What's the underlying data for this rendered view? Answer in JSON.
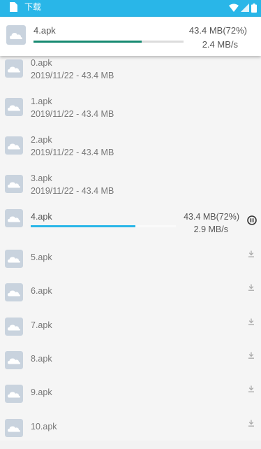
{
  "status_bar": {
    "title": "下载",
    "icons": [
      "document-icon",
      "wifi-icon",
      "signal-icon",
      "battery-icon"
    ]
  },
  "active_card": {
    "name": "4.apk",
    "size": "43.4 MB(72%)",
    "speed": "2.4 MB/s",
    "progress": 0.72,
    "colors": {
      "fill": "#188a72",
      "track": "#dcdcdc"
    }
  },
  "rows": [
    {
      "name": "0.apk",
      "meta": "2019/11/22 - 43.4 MB"
    },
    {
      "name": "1.apk",
      "meta": "2019/11/22 - 43.4 MB"
    },
    {
      "name": "2.apk",
      "meta": "2019/11/22 - 43.4 MB"
    },
    {
      "name": "3.apk",
      "meta": "2019/11/22 - 43.4 MB"
    },
    {
      "name": "4.apk",
      "size": "43.4 MB(72%)",
      "speed": "2.9 MB/s",
      "progress": 0.72,
      "action": "pause-icon"
    },
    {
      "name": "5.apk",
      "action": "download-icon"
    },
    {
      "name": "6.apk",
      "action": "download-icon"
    },
    {
      "name": "7.apk",
      "action": "download-icon"
    },
    {
      "name": "8.apk",
      "action": "download-icon"
    },
    {
      "name": "9.apk",
      "action": "download-icon"
    },
    {
      "name": "10.apk",
      "action": "download-icon"
    }
  ],
  "colors": {
    "status_bar": "#29b6e8",
    "progress": "#29b6e8",
    "thumb": "#c9d3de"
  }
}
